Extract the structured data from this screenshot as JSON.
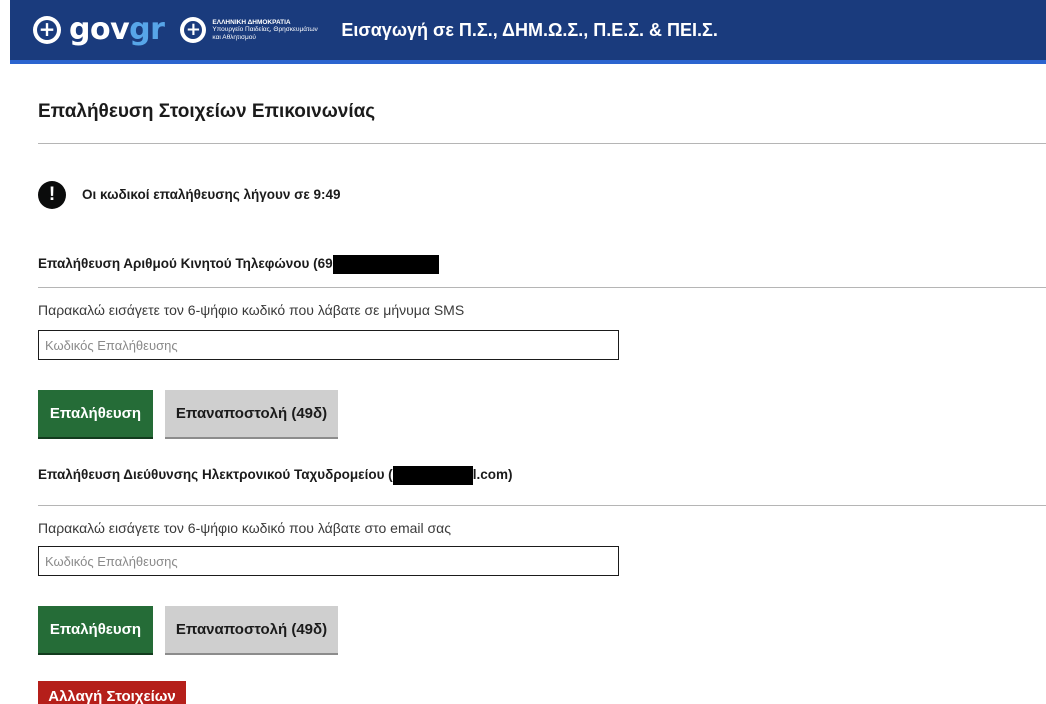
{
  "header": {
    "logo_gov": "gov",
    "logo_gr": "gr",
    "ministry_line1": "ΕΛΛΗΝΙΚΗ ΔΗΜΟΚΡΑΤΙΑ",
    "ministry_line2": "Υπουργείο Παιδείας, Θρησκευμάτων",
    "ministry_line3": "και Αθλητισμού",
    "title": "Εισαγωγή σε Π.Σ., ΔΗΜ.Ω.Σ., Π.Ε.Σ. & ΠΕΙ.Σ.",
    "background_color": "#1a3b7d"
  },
  "page": {
    "title": "Επαλήθευση Στοιχείων Επικοινωνίας"
  },
  "alert": {
    "icon": "exclamation-icon",
    "text": "Οι κωδικοί επαλήθευσης λήγουν σε 9:49"
  },
  "phone_section": {
    "title_prefix": "Επαλήθευση Αριθμού Κινητού Τηλεφώνου (69",
    "instruction": "Παρακαλώ εισάγετε τον 6-ψήφιο κωδικό που λάβατε σε μήνυμα SMS",
    "input_placeholder": "Κωδικός Επαλήθευσης",
    "verify_label": "Επαλήθευση",
    "resend_label": "Επαναποστολή (49δ)"
  },
  "email_section": {
    "title_prefix": "Επαλήθευση Διεύθυνσης Ηλεκτρονικού Ταχυδρομείου (",
    "title_suffix": "l.com)",
    "instruction": "Παρακαλώ εισάγετε τον 6-ψήφιο κωδικό που λάβατε στο email σας",
    "input_placeholder": "Κωδικός Επαλήθευσης",
    "verify_label": "Επαλήθευση",
    "resend_label": "Επαναποστολή (49δ)"
  },
  "change_details_label": "Αλλαγή Στοιχείων",
  "colors": {
    "primary_button": "#256c37",
    "secondary_button": "#cfcfcf",
    "danger_button": "#b51f1a"
  }
}
